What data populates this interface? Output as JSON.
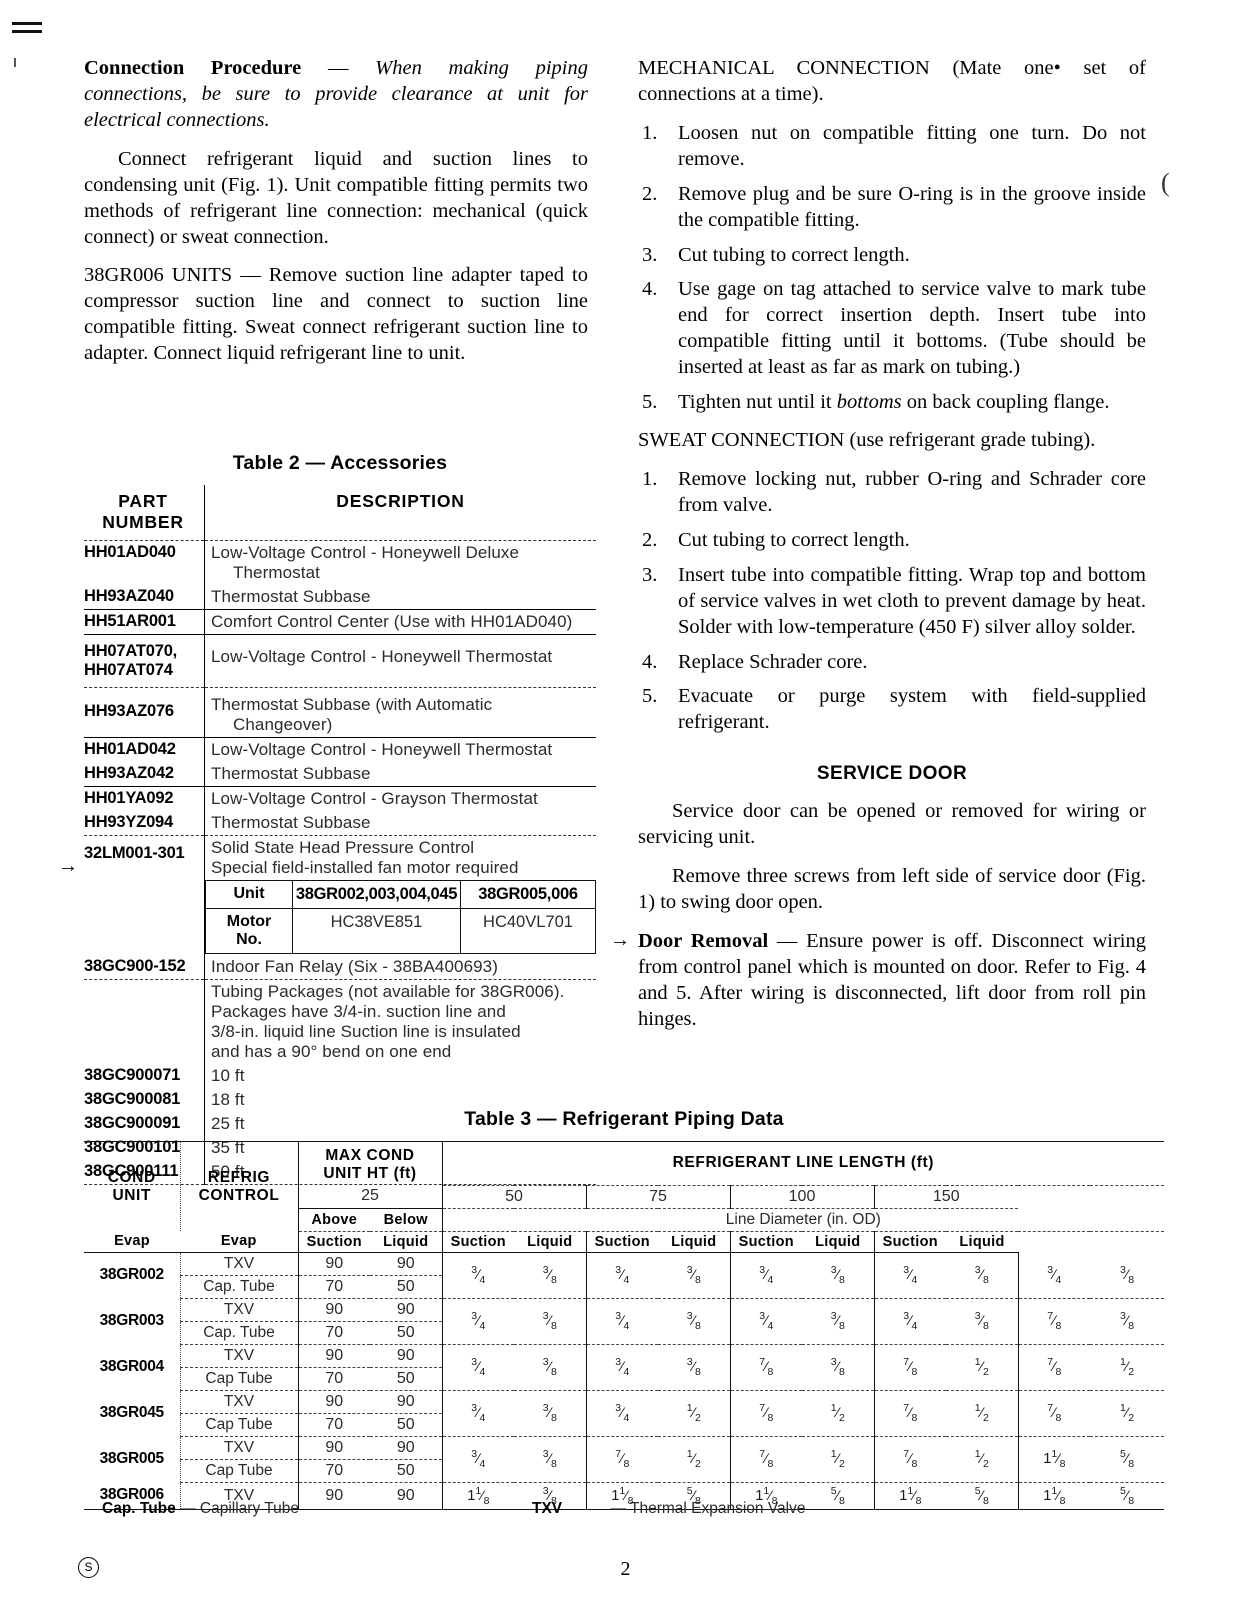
{
  "page": {
    "number": "2",
    "copyright_symbol": "S"
  },
  "left_column": {
    "connection_procedure": {
      "heading": "Connection Procedure",
      "dash": " — ",
      "italic_text": "When making piping connections, be sure to provide clearance at unit for electrical connections."
    },
    "para_connect": "Connect refrigerant liquid and suction lines to condensing unit (Fig. 1). Unit compatible fitting permits two methods of refrigerant line connection: mechanical (quick connect) or sweat connection.",
    "units_38gr006": {
      "heading": "38GR006 UNITS",
      "dash": " — ",
      "text": "Remove suction line adapter taped to compressor suction line and connect to suction line compatible fitting. Sweat connect refrigerant suction line to adapter. Connect liquid refrigerant line to unit."
    }
  },
  "right_column": {
    "mechanical_connection": {
      "heading": "MECHANICAL CONNECTION",
      "suffix": " (Mate one• set of connections at a time).",
      "steps": [
        "Loosen nut on compatible fitting one turn. Do not remove.",
        "Remove plug and be sure O-ring is in the groove inside the compatible fitting.",
        "Cut tubing to correct length.",
        "Use gage on tag attached to service valve to mark tube end for correct insertion depth. Insert tube into compatible fitting until it bottoms. (Tube should be inserted at least as far as mark on tubing.)",
        "Tighten nut until it bottoms on back coupling flange."
      ],
      "step5_italic_word": "bottoms"
    },
    "sweat_connection": {
      "heading": "SWEAT CONNECTION",
      "suffix": " (use refrigerant grade tubing).",
      "steps": [
        "Remove locking nut, rubber O-ring and Schrader core from valve.",
        "Cut tubing to correct length.",
        "Insert tube into compatible fitting. Wrap top and bottom of service valves in wet cloth to prevent damage by heat. Solder with low-temperature (450 F) silver alloy solder.",
        "Replace Schrader core.",
        "Evacuate or purge system with field-supplied refrigerant."
      ]
    },
    "service_door": {
      "heading": "SERVICE DOOR",
      "para1": "Service door can be opened or removed for wiring or servicing unit.",
      "para2": "Remove three screws from left side of service door (Fig. 1) to swing door open.",
      "door_removal_heading": "Door Removal",
      "door_removal_dash": " — ",
      "door_removal_text": "Ensure power is off. Disconnect wiring from control panel which is mounted on door. Refer to Fig. 4 and 5. After wiring is disconnected, lift door from roll pin hinges."
    }
  },
  "table2": {
    "title": "Table 2 — Accessories",
    "headers": {
      "part_number": "PART\nNUMBER",
      "part_number_l1": "PART",
      "part_number_l2": "NUMBER",
      "description": "DESCRIPTION"
    },
    "rows": [
      {
        "part": "HH01AD040",
        "desc": "Low-Voltage Control - Honeywell Deluxe",
        "desc2": "Thermostat",
        "rule": "none"
      },
      {
        "part": "HH93AZ040",
        "desc": "Thermostat Subbase",
        "rule": "solid"
      },
      {
        "part": "HH51AR001",
        "desc": "Comfort Control Center (Use with HH01AD040)",
        "rule": "solid"
      },
      {
        "part": "HH07AT070,",
        "part2": "HH07AT074",
        "desc": "Low-Voltage Control - Honeywell Thermostat",
        "rule": "dashed"
      },
      {
        "part": "HH93AZ076",
        "desc": "Thermostat Subbase (with Automatic",
        "desc2": "Changeover)",
        "rule": "solid"
      },
      {
        "part": "HH01AD042",
        "desc": "Low-Voltage Control - Honeywell Thermostat",
        "rule": "none"
      },
      {
        "part": "HH93AZ042",
        "desc": "Thermostat Subbase",
        "rule": "solid"
      },
      {
        "part": "HH01YA092",
        "desc": "Low-Voltage Control - Grayson Thermostat",
        "rule": "none"
      },
      {
        "part": "HH93YZ094",
        "desc": "Thermostat Subbase",
        "rule": "dashed"
      },
      {
        "part": "32LM001-301",
        "desc": "Solid State Head Pressure Control",
        "desc2": "Special field-installed fan motor required",
        "rule": "none"
      }
    ],
    "motor_table": {
      "unit_label": "Unit",
      "motor_label_l1": "Motor",
      "motor_label_l2": "No.",
      "units": [
        "38GR002,003,004,045",
        "38GR005,006"
      ],
      "motors": [
        "HC38VE851",
        "HC40VL701"
      ]
    },
    "fan_relay": {
      "part": "38GC900-152",
      "desc": "Indoor Fan Relay (Six - 38BA400693)"
    },
    "tubing": {
      "note_lines": [
        "Tubing Packages (not available for 38GR006).",
        "Packages have 3/4-in. suction line and",
        "3/8-in. liquid line   Suction line is insulated",
        "and has a 90° bend on one end"
      ],
      "packages": [
        {
          "part": "38GC900071",
          "length": "10 ft"
        },
        {
          "part": "38GC900081",
          "length": "18 ft"
        },
        {
          "part": "38GC900091",
          "length": "25 ft"
        },
        {
          "part": "38GC900101",
          "length": "35 ft"
        },
        {
          "part": "38GC900111",
          "length": "50 ft"
        }
      ]
    }
  },
  "table3": {
    "title": "Table 3 — Refrigerant Piping Data",
    "headers": {
      "cond_unit_l1": "COND",
      "cond_unit_l2": "UNIT",
      "refrig_control_l1": "REFRIG",
      "refrig_control_l2": "CONTROL",
      "max_cond_l1": "MAX COND",
      "max_cond_l2": "UNIT HT (ft)",
      "above_evap_l1": "Above",
      "above_evap_l2": "Evap",
      "below_evap_l1": "Below",
      "below_evap_l2": "Evap",
      "line_length": "REFRIGERANT LINE LENGTH (ft)",
      "line_diameter": "Line Diameter (in. OD)",
      "suction": "Suction",
      "liquid": "Liquid"
    },
    "lengths": [
      "25",
      "50",
      "75",
      "100",
      "150"
    ],
    "rows": [
      {
        "unit": "38GR002",
        "controls": [
          {
            "name": "TXV",
            "above": "90",
            "below": "90"
          },
          {
            "name": "Cap. Tube",
            "above": "70",
            "below": "50"
          }
        ],
        "diameters": [
          {
            "suction": "3/4",
            "liquid": "3/8"
          },
          {
            "suction": "3/4",
            "liquid": "3/8"
          },
          {
            "suction": "3/4",
            "liquid": "3/8"
          },
          {
            "suction": "3/4",
            "liquid": "3/8"
          },
          {
            "suction": "3/4",
            "liquid": "3/8"
          }
        ]
      },
      {
        "unit": "38GR003",
        "controls": [
          {
            "name": "TXV",
            "above": "90",
            "below": "90"
          },
          {
            "name": "Cap. Tube",
            "above": "70",
            "below": "50"
          }
        ],
        "diameters": [
          {
            "suction": "3/4",
            "liquid": "3/8"
          },
          {
            "suction": "3/4",
            "liquid": "3/8"
          },
          {
            "suction": "3/4",
            "liquid": "3/8"
          },
          {
            "suction": "3/4",
            "liquid": "3/8"
          },
          {
            "suction": "7/8",
            "liquid": "3/8"
          }
        ]
      },
      {
        "unit": "38GR004",
        "controls": [
          {
            "name": "TXV",
            "above": "90",
            "below": "90"
          },
          {
            "name": "Cap  Tube",
            "above": "70",
            "below": "50"
          }
        ],
        "diameters": [
          {
            "suction": "3/4",
            "liquid": "3/8"
          },
          {
            "suction": "3/4",
            "liquid": "3/8"
          },
          {
            "suction": "7/8",
            "liquid": "3/8"
          },
          {
            "suction": "7/8",
            "liquid": "1/2"
          },
          {
            "suction": "7/8",
            "liquid": "1/2"
          }
        ]
      },
      {
        "unit": "38GR045",
        "controls": [
          {
            "name": "TXV",
            "above": "90",
            "below": "90"
          },
          {
            "name": "Cap  Tube",
            "above": "70",
            "below": "50"
          }
        ],
        "diameters": [
          {
            "suction": "3/4",
            "liquid": "3/8"
          },
          {
            "suction": "3/4",
            "liquid": "1/2"
          },
          {
            "suction": "7/8",
            "liquid": "1/2"
          },
          {
            "suction": "7/8",
            "liquid": "1/2"
          },
          {
            "suction": "7/8",
            "liquid": "1/2"
          }
        ]
      },
      {
        "unit": "38GR005",
        "controls": [
          {
            "name": "TXV",
            "above": "90",
            "below": "90"
          },
          {
            "name": "Cap  Tube",
            "above": "70",
            "below": "50"
          }
        ],
        "diameters": [
          {
            "suction": "3/4",
            "liquid": "3/8"
          },
          {
            "suction": "7/8",
            "liquid": "1/2"
          },
          {
            "suction": "7/8",
            "liquid": "1/2"
          },
          {
            "suction": "7/8",
            "liquid": "1/2"
          },
          {
            "suction": "1 1/8",
            "liquid": "5/8"
          }
        ]
      },
      {
        "unit": "38GR006",
        "controls": [
          {
            "name": "TXV",
            "above": "90",
            "below": "90"
          }
        ],
        "diameters": [
          {
            "suction": "1 1/8",
            "liquid": "3/8"
          },
          {
            "suction": "1 1/8",
            "liquid": "5/8"
          },
          {
            "suction": "1 1/8",
            "liquid": "5/8"
          },
          {
            "suction": "1 1/8",
            "liquid": "5/8"
          },
          {
            "suction": "1 1/8",
            "liquid": "5/8"
          }
        ]
      }
    ],
    "footnotes": {
      "cap_tube_abbr": "Cap. Tube",
      "cap_tube_dash": " — ",
      "cap_tube_text": "Capillary Tube",
      "txv_abbr": "TXV",
      "txv_dash": " — ",
      "txv_text": "Thermal Expansion Valve"
    }
  }
}
